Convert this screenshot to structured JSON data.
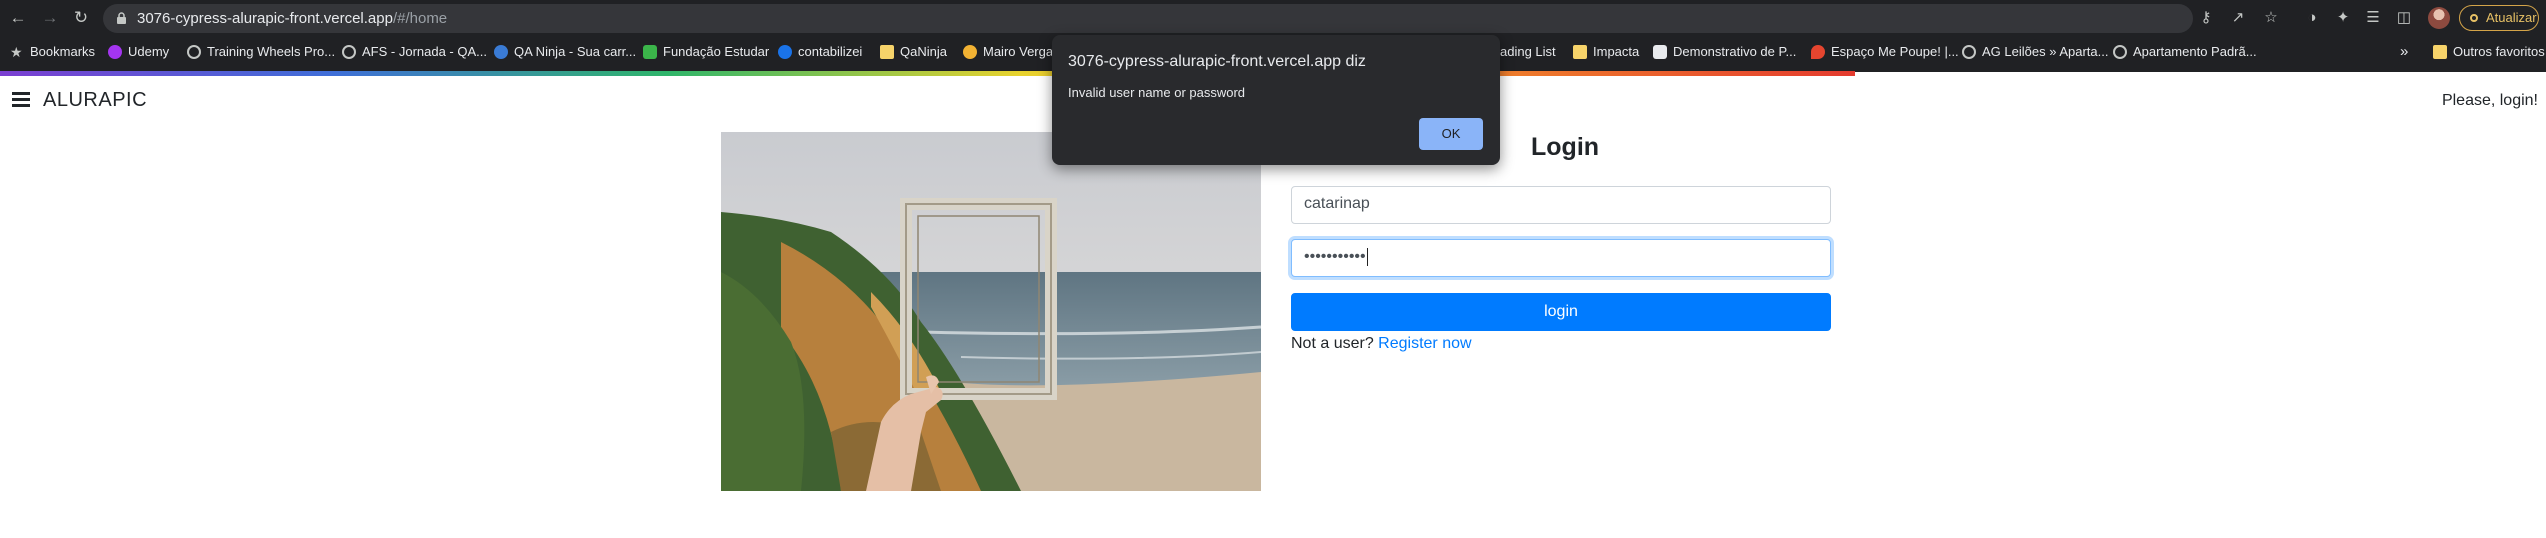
{
  "browser": {
    "url_host": "3076-cypress-alurapic-front.vercel.app",
    "url_path": "/#/home",
    "update_label": "Atualizar"
  },
  "bookmarks": {
    "items": [
      {
        "label": "Bookmarks",
        "icon": "star-icon"
      },
      {
        "label": "Udemy",
        "icon": "udemy-icon"
      },
      {
        "label": "Training Wheels Pro...",
        "icon": "globe-icon"
      },
      {
        "label": "AFS - Jornada - QA...",
        "icon": "globe-icon"
      },
      {
        "label": "QA Ninja - Sua carr...",
        "icon": "ninja-icon"
      },
      {
        "label": "Fundação Estudar",
        "icon": "fe-icon"
      },
      {
        "label": "contabilizei",
        "icon": "contabilizei-icon"
      },
      {
        "label": "QaNinja",
        "icon": "folder-icon"
      },
      {
        "label": "Mairo Vergar",
        "icon": "site-icon"
      },
      {
        "label": "ading List",
        "icon": "reading-list-icon"
      },
      {
        "label": "Impacta",
        "icon": "folder-icon"
      },
      {
        "label": "Demonstrativo de P...",
        "icon": "doc-icon"
      },
      {
        "label": "Espaço Me Poupe! |...",
        "icon": "flame-icon"
      },
      {
        "label": "AG Leilões » Aparta...",
        "icon": "globe-icon"
      },
      {
        "label": "Apartamento Padrã...",
        "icon": "globe-icon"
      }
    ],
    "overflow": "»",
    "other_label": "Outros favoritos"
  },
  "header": {
    "brand": "ALURAPIC",
    "login_prompt": "Please, login!"
  },
  "form": {
    "title": "Login",
    "username_value": "catarinap",
    "password_value": "•••••••••••",
    "button_label": "login",
    "signup_prefix": "Not a user?",
    "signup_link": "Register now"
  },
  "dialog": {
    "title": "3076-cypress-alurapic-front.vercel.app diz",
    "message": "Invalid user name or password",
    "ok_label": "OK"
  },
  "colors": {
    "chrome_bg": "#202124",
    "primary": "#007bff",
    "dialog_bg": "#292a2d",
    "dialog_button": "#8ab4f8"
  }
}
